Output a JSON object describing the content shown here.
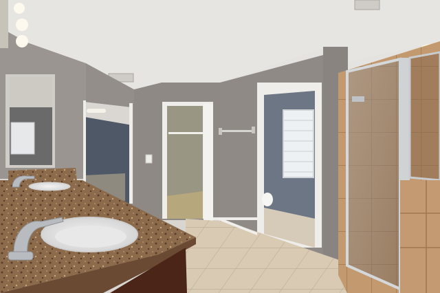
{
  "photo": {
    "subject": "bathroom-interior"
  },
  "colors": {
    "ceiling": "#e4e2de",
    "wall_main": "#8f8a86",
    "wall_left": "#9a9490",
    "blue_room": "#545d6b",
    "closet": "#9a9684",
    "floor_tile": "#d6c7b0",
    "granite": "#8a6a4a",
    "cabinet": "#4a2518",
    "shower_tile": "#b68a62",
    "trim": "#f2f0ec"
  }
}
